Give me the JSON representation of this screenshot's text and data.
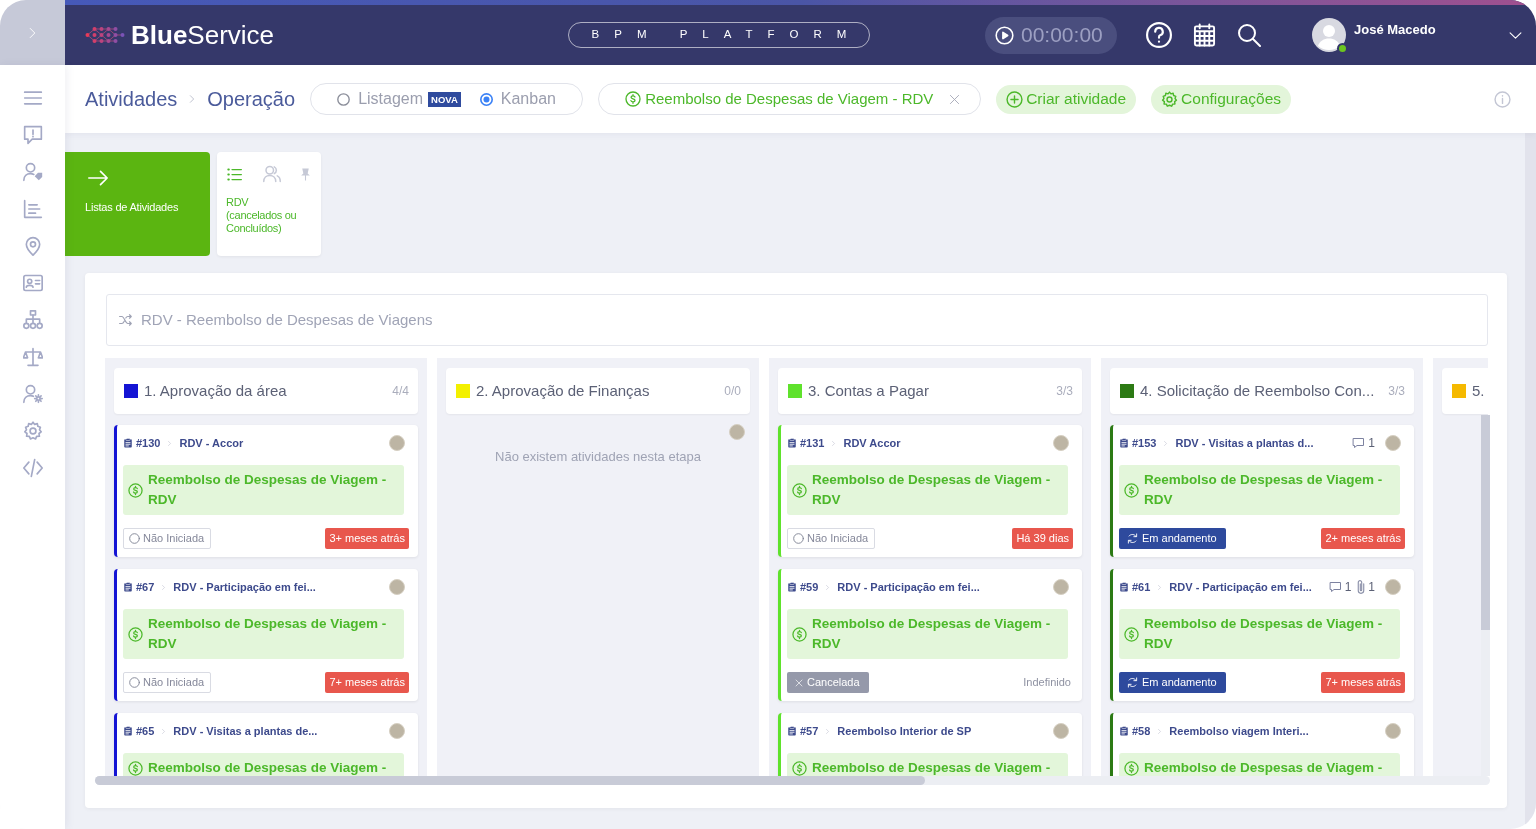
{
  "app": {
    "brand": "**Blue**Service",
    "platform": "BPM PLATFORM",
    "timer": "00:00:00"
  },
  "user": {
    "name": "José Macedo",
    "online": true
  },
  "breadcrumb": [
    "Atividades",
    "Operação"
  ],
  "view_toggle": [
    {
      "label": "Listagem",
      "badge": "NOVA",
      "selected": false
    },
    {
      "label": "Kanban",
      "selected": true
    }
  ],
  "filter": {
    "label": "Reembolso de Despesas de Viagem - RDV"
  },
  "actions": [
    {
      "kind": "create",
      "label": "Criar atividade"
    },
    {
      "kind": "settings",
      "label": "Configurações"
    }
  ],
  "quick_tiles": [
    {
      "kind": "primary",
      "label": "Listas de Atividades"
    },
    {
      "kind": "saved_list",
      "label": "RDV (cancelados ou Concluídos)"
    }
  ],
  "board": {
    "title": "RDV - Reembolso de Despesas de Viagens",
    "columns": [
      {
        "title": "1. Aprovação da área",
        "count": "4/4",
        "color": "#1414d4",
        "cards": [
          {
            "id": "#130",
            "title": "RDV - Accor",
            "process": "Reembolso de Despesas de Viagem - RDV",
            "status": {
              "kind": "not_started",
              "label": "Não Iniciada"
            },
            "due": {
              "kind": "overdue",
              "label": "3+ meses atrás"
            }
          },
          {
            "id": "#67",
            "title": "RDV - Participação em fei...",
            "process": "Reembolso de Despesas de Viagem - RDV",
            "status": {
              "kind": "not_started",
              "label": "Não Iniciada"
            },
            "due": {
              "kind": "overdue",
              "label": "7+ meses atrás"
            }
          },
          {
            "id": "#65",
            "title": "RDV - Visitas a plantas de...",
            "process": "Reembolso de Despesas de Viagem -"
          }
        ]
      },
      {
        "title": "2. Aprovação de Finanças",
        "count": "0/0",
        "color": "#f3f000",
        "empty_message": "Não existem atividades nesta etapa"
      },
      {
        "title": "3. Contas a Pagar",
        "count": "3/3",
        "color": "#5fe22c",
        "cards": [
          {
            "id": "#131",
            "title": "RDV Accor",
            "process": "Reembolso de Despesas de Viagem - RDV",
            "status": {
              "kind": "not_started",
              "label": "Não Iniciada"
            },
            "due": {
              "kind": "overdue",
              "label": "Há 39 dias"
            }
          },
          {
            "id": "#59",
            "title": "RDV - Participação em fei...",
            "process": "Reembolso de Despesas de Viagem - RDV",
            "status": {
              "kind": "cancelled",
              "label": "Cancelada"
            },
            "due": {
              "kind": "plain",
              "label": "Indefinido"
            }
          },
          {
            "id": "#57",
            "title": "Reembolso Interior de SP",
            "process": "Reembolso de Despesas de Viagem -"
          }
        ]
      },
      {
        "title": "4. Solicitação de Reembolso Con...",
        "count": "3/3",
        "color": "#2c7a14",
        "cards": [
          {
            "id": "#153",
            "title": "RDV - Visitas a plantas d...",
            "comments": "1",
            "process": "Reembolso de Despesas de Viagem - RDV",
            "status": {
              "kind": "in_progress",
              "label": "Em andamento"
            },
            "due": {
              "kind": "overdue",
              "label": "2+ meses atrás"
            }
          },
          {
            "id": "#61",
            "title": "RDV - Participação em fei...",
            "comments": "1",
            "attachments": "1",
            "process": "Reembolso de Despesas de Viagem - RDV",
            "status": {
              "kind": "in_progress",
              "label": "Em andamento"
            },
            "due": {
              "kind": "overdue",
              "label": "7+ meses atrás"
            }
          },
          {
            "id": "#58",
            "title": "Reembolso viagem Interi...",
            "process": "Reembolso de Despesas de Viagem -"
          }
        ]
      },
      {
        "title": "5.",
        "color": "#f5b900"
      }
    ]
  }
}
